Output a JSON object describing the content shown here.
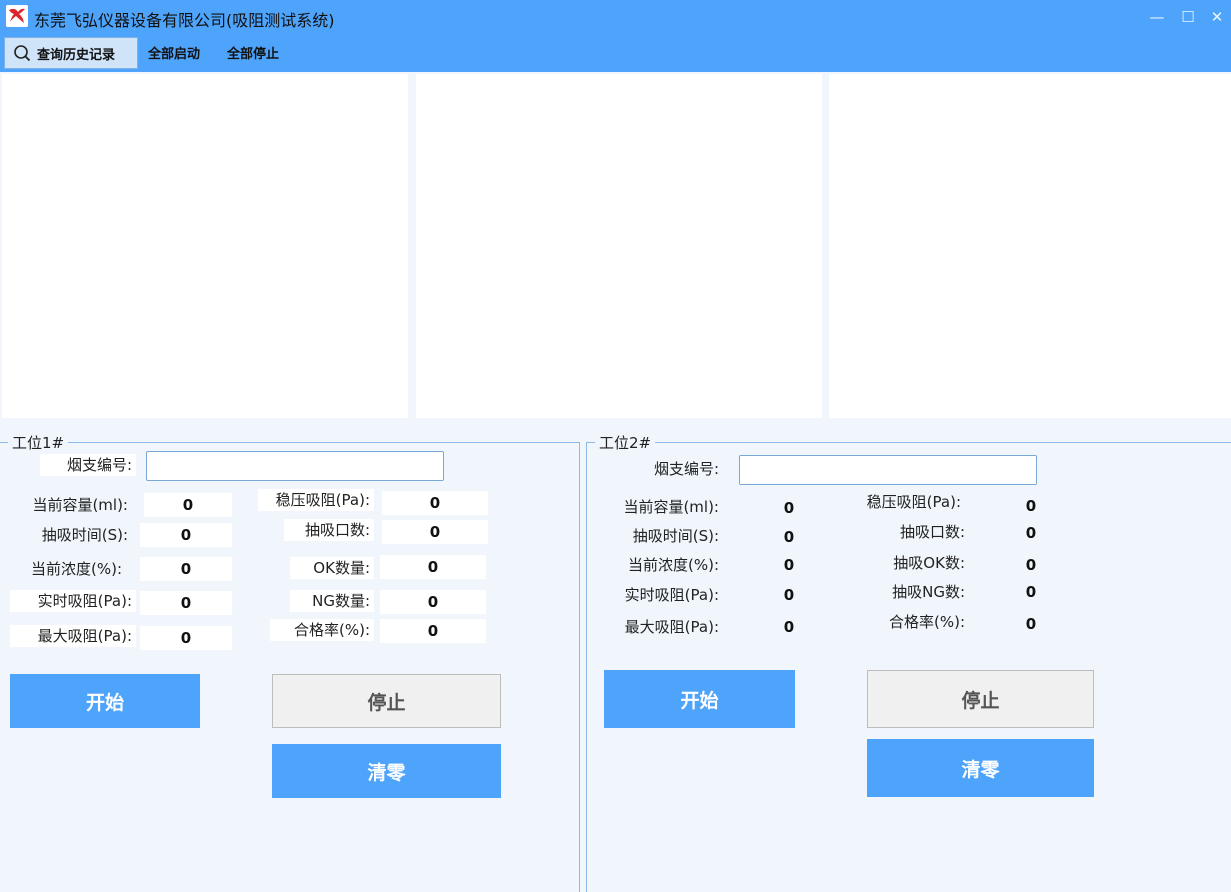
{
  "window": {
    "title": "东莞飞弘仪器设备有限公司(吸阻测试系统)",
    "icon": "app-logo-icon",
    "controls": {
      "minimize": "—",
      "maximize": "☐",
      "close": "✕"
    }
  },
  "toolbar": {
    "query_history": "查询历史记录",
    "start_all": "全部启动",
    "stop_all": "全部停止"
  },
  "colors": {
    "accent": "#4ea3fb",
    "background": "#f0f6fc",
    "panel": "#ffffff"
  },
  "station1": {
    "title": "工位1#",
    "cig_id_label": "烟支编号:",
    "cig_id_value": "",
    "fields": {
      "current_volume_label": "当前容量(ml):",
      "current_volume": "0",
      "puff_time_label": "抽吸时间(S):",
      "puff_time": "0",
      "current_concentration_label": "当前浓度(%):",
      "current_concentration": "0",
      "realtime_resistance_label": "实时吸阻(Pa):",
      "realtime_resistance": "0",
      "max_resistance_label": "最大吸阻(Pa):",
      "max_resistance": "0",
      "stable_resistance_label": "稳压吸阻(Pa):",
      "stable_resistance": "0",
      "puff_count_label": "抽吸口数:",
      "puff_count": "0",
      "ok_count_label": "OK数量:",
      "ok_count": "0",
      "ng_count_label": "NG数量:",
      "ng_count": "0",
      "pass_rate_label": "合格率(%):",
      "pass_rate": "0"
    },
    "buttons": {
      "start": "开始",
      "stop": "停止",
      "reset": "清零"
    }
  },
  "station2": {
    "title": "工位2#",
    "cig_id_label": "烟支编号:",
    "cig_id_value": "",
    "fields": {
      "current_volume_label": "当前容量(ml):",
      "current_volume": "0",
      "puff_time_label": "抽吸时间(S):",
      "puff_time": "0",
      "current_concentration_label": "当前浓度(%):",
      "current_concentration": "0",
      "realtime_resistance_label": "实时吸阻(Pa):",
      "realtime_resistance": "0",
      "max_resistance_label": "最大吸阻(Pa):",
      "max_resistance": "0",
      "stable_resistance_label": "稳压吸阻(Pa):",
      "stable_resistance": "0",
      "puff_count_label": "抽吸口数:",
      "puff_count": "0",
      "ok_count_label": "抽吸OK数:",
      "ok_count": "0",
      "ng_count_label": "抽吸NG数:",
      "ng_count": "0",
      "pass_rate_label": "合格率(%):",
      "pass_rate": "0"
    },
    "buttons": {
      "start": "开始",
      "stop": "停止",
      "reset": "清零"
    }
  }
}
